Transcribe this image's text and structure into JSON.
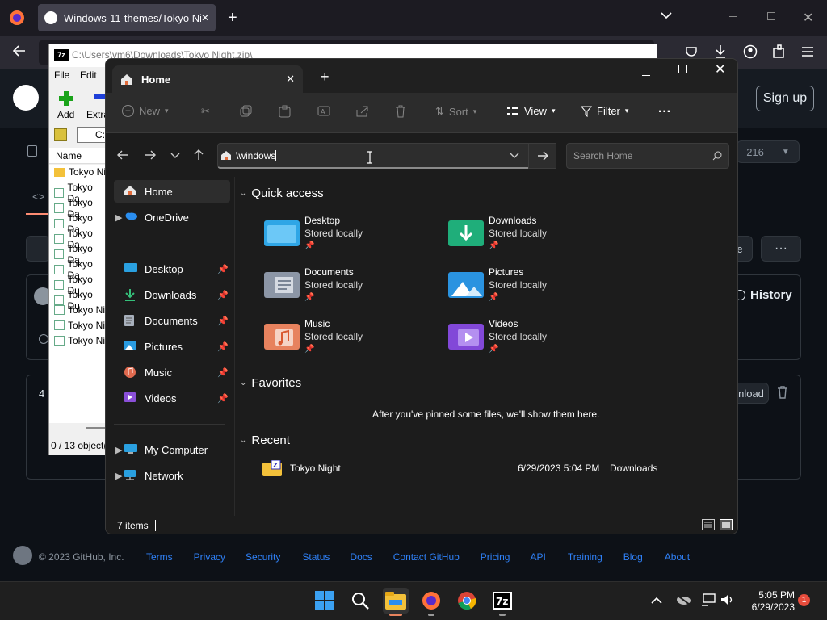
{
  "browser": {
    "tab_title": "Windows-11-themes/Tokyo Ni",
    "close_glyph": "✕",
    "new_tab_glyph": "+"
  },
  "github": {
    "sign_up": "Sign up",
    "partial_signin": "n",
    "history": "History",
    "count": "216",
    "row_count_partial": "4",
    "download_partial": "nload",
    "partial_e": "e",
    "footer_copyright": "© 2023 GitHub, Inc.",
    "footer_links": [
      "Terms",
      "Privacy",
      "Security",
      "Status",
      "Docs",
      "Contact GitHub",
      "Pricing",
      "API",
      "Training",
      "Blog",
      "About"
    ]
  },
  "zip": {
    "title": "C:\\Users\\vm6\\Downloads\\Tokyo Night.zip\\",
    "menu": [
      "File",
      "Edit"
    ],
    "add_label": "Add",
    "extract_label": "Extra",
    "path_partial": "C:",
    "column_name": "Name",
    "rows": [
      "Tokyo Ni",
      "Tokyo Da",
      "Tokyo Da",
      "Tokyo Da",
      "Tokyo Da",
      "Tokyo Da",
      "Tokyo Da",
      "Tokyo Du",
      "Tokyo Du",
      "Tokyo Ni",
      "Tokyo Ni",
      "Tokyo Ni"
    ],
    "status": "0 / 13 object("
  },
  "explorer": {
    "tab_title": "Home",
    "commands": {
      "new": "New",
      "sort": "Sort",
      "view": "View",
      "filter": "Filter",
      "more": "···"
    },
    "address_value": "\\windows",
    "search_placeholder": "Search Home",
    "nav": {
      "home": "Home",
      "onedrive": "OneDrive",
      "desktop": "Desktop",
      "downloads": "Downloads",
      "documents": "Documents",
      "pictures": "Pictures",
      "music": "Music",
      "videos": "Videos",
      "my_computer": "My Computer",
      "network": "Network"
    },
    "quick_access_title": "Quick access",
    "stored_locally": "Stored locally",
    "quick_access": [
      {
        "name": "Desktop",
        "sub": "Stored locally"
      },
      {
        "name": "Downloads",
        "sub": "Stored locally"
      },
      {
        "name": "Documents",
        "sub": "Stored locally"
      },
      {
        "name": "Pictures",
        "sub": "Stored locally"
      },
      {
        "name": "Music",
        "sub": "Stored locally"
      },
      {
        "name": "Videos",
        "sub": "Stored locally"
      }
    ],
    "favorites_title": "Favorites",
    "favorites_empty": "After you've pinned some files, we'll show them here.",
    "recent_title": "Recent",
    "recent": [
      {
        "name": "Tokyo Night",
        "date": "6/29/2023 5:04 PM",
        "location": "Downloads"
      }
    ],
    "status_items": "7 items"
  },
  "taskbar": {
    "time": "5:05 PM",
    "date": "6/29/2023",
    "notification_count": "1"
  },
  "colors": {
    "accent": "#2f81f7",
    "folder_yellow": "#f3c13a",
    "notification": "#e74c3c"
  }
}
